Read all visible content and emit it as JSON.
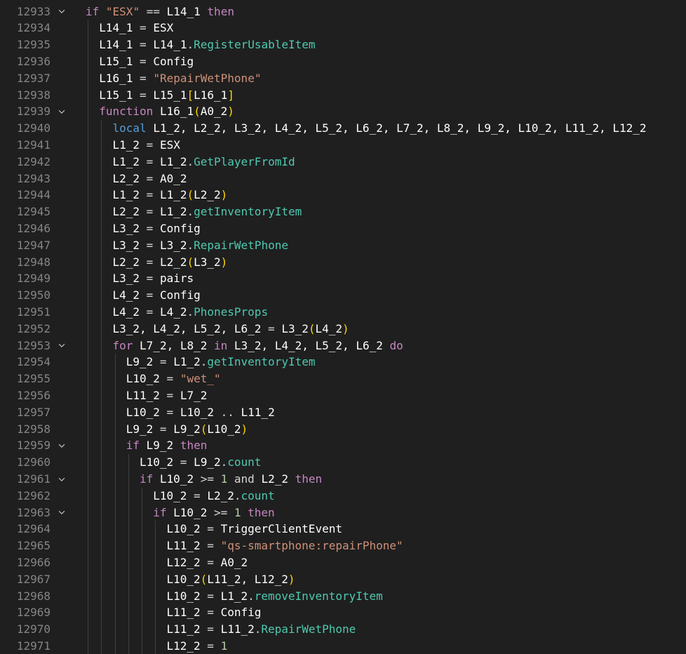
{
  "editor": {
    "first_line": 12933,
    "fold_icon": "chevron-down-icon",
    "colors": {
      "background": "#1f1f1f",
      "line_number": "#858585",
      "keyword": "#c586c0",
      "local_keyword": "#569cd6",
      "string": "#ce9178",
      "property": "#4ec9b0",
      "number": "#b5cea8",
      "bracket": "#ffd700",
      "identifier": "#ffffff"
    },
    "lines": [
      {
        "n": "12933",
        "fold": true,
        "indent": 0,
        "tokens": [
          [
            "kw",
            "if"
          ],
          [
            "op",
            " "
          ],
          [
            "str",
            "\"ESX\""
          ],
          [
            "op",
            " == "
          ],
          [
            "var",
            "L14_1"
          ],
          [
            "op",
            " "
          ],
          [
            "kw",
            "then"
          ]
        ]
      },
      {
        "n": "12934",
        "fold": false,
        "indent": 1,
        "tokens": [
          [
            "var",
            "L14_1"
          ],
          [
            "op",
            " = "
          ],
          [
            "var",
            "ESX"
          ]
        ]
      },
      {
        "n": "12935",
        "fold": false,
        "indent": 1,
        "tokens": [
          [
            "var",
            "L14_1"
          ],
          [
            "op",
            " = "
          ],
          [
            "var",
            "L14_1"
          ],
          [
            "op",
            "."
          ],
          [
            "fn",
            "RegisterUsableItem"
          ]
        ]
      },
      {
        "n": "12936",
        "fold": false,
        "indent": 1,
        "tokens": [
          [
            "var",
            "L15_1"
          ],
          [
            "op",
            " = "
          ],
          [
            "var",
            "Config"
          ]
        ]
      },
      {
        "n": "12937",
        "fold": false,
        "indent": 1,
        "tokens": [
          [
            "var",
            "L16_1"
          ],
          [
            "op",
            " = "
          ],
          [
            "str",
            "\"RepairWetPhone\""
          ]
        ]
      },
      {
        "n": "12938",
        "fold": false,
        "indent": 1,
        "tokens": [
          [
            "var",
            "L15_1"
          ],
          [
            "op",
            " = "
          ],
          [
            "var",
            "L15_1"
          ],
          [
            "br",
            "["
          ],
          [
            "var",
            "L16_1"
          ],
          [
            "br",
            "]"
          ]
        ]
      },
      {
        "n": "12939",
        "fold": true,
        "indent": 1,
        "tokens": [
          [
            "kw",
            "function"
          ],
          [
            "op",
            " "
          ],
          [
            "var",
            "L16_1"
          ],
          [
            "br",
            "("
          ],
          [
            "var",
            "A0_2"
          ],
          [
            "br",
            ")"
          ]
        ]
      },
      {
        "n": "12940",
        "fold": false,
        "indent": 2,
        "tokens": [
          [
            "kwb",
            "local"
          ],
          [
            "op",
            " "
          ],
          [
            "var",
            "L1_2, L2_2, L3_2, L4_2, L5_2, L6_2, L7_2, L8_2, L9_2, L10_2, L11_2, L12_2"
          ]
        ]
      },
      {
        "n": "12941",
        "fold": false,
        "indent": 2,
        "tokens": [
          [
            "var",
            "L1_2"
          ],
          [
            "op",
            " = "
          ],
          [
            "var",
            "ESX"
          ]
        ]
      },
      {
        "n": "12942",
        "fold": false,
        "indent": 2,
        "tokens": [
          [
            "var",
            "L1_2"
          ],
          [
            "op",
            " = "
          ],
          [
            "var",
            "L1_2"
          ],
          [
            "op",
            "."
          ],
          [
            "fn",
            "GetPlayerFromId"
          ]
        ]
      },
      {
        "n": "12943",
        "fold": false,
        "indent": 2,
        "tokens": [
          [
            "var",
            "L2_2"
          ],
          [
            "op",
            " = "
          ],
          [
            "var",
            "A0_2"
          ]
        ]
      },
      {
        "n": "12944",
        "fold": false,
        "indent": 2,
        "tokens": [
          [
            "var",
            "L1_2"
          ],
          [
            "op",
            " = "
          ],
          [
            "var",
            "L1_2"
          ],
          [
            "br",
            "("
          ],
          [
            "var",
            "L2_2"
          ],
          [
            "br",
            ")"
          ]
        ]
      },
      {
        "n": "12945",
        "fold": false,
        "indent": 2,
        "tokens": [
          [
            "var",
            "L2_2"
          ],
          [
            "op",
            " = "
          ],
          [
            "var",
            "L1_2"
          ],
          [
            "op",
            "."
          ],
          [
            "fn",
            "getInventoryItem"
          ]
        ]
      },
      {
        "n": "12946",
        "fold": false,
        "indent": 2,
        "tokens": [
          [
            "var",
            "L3_2"
          ],
          [
            "op",
            " = "
          ],
          [
            "var",
            "Config"
          ]
        ]
      },
      {
        "n": "12947",
        "fold": false,
        "indent": 2,
        "tokens": [
          [
            "var",
            "L3_2"
          ],
          [
            "op",
            " = "
          ],
          [
            "var",
            "L3_2"
          ],
          [
            "op",
            "."
          ],
          [
            "fn",
            "RepairWetPhone"
          ]
        ]
      },
      {
        "n": "12948",
        "fold": false,
        "indent": 2,
        "tokens": [
          [
            "var",
            "L2_2"
          ],
          [
            "op",
            " = "
          ],
          [
            "var",
            "L2_2"
          ],
          [
            "br",
            "("
          ],
          [
            "var",
            "L3_2"
          ],
          [
            "br",
            ")"
          ]
        ]
      },
      {
        "n": "12949",
        "fold": false,
        "indent": 2,
        "tokens": [
          [
            "var",
            "L3_2"
          ],
          [
            "op",
            " = "
          ],
          [
            "var",
            "pairs"
          ]
        ]
      },
      {
        "n": "12950",
        "fold": false,
        "indent": 2,
        "tokens": [
          [
            "var",
            "L4_2"
          ],
          [
            "op",
            " = "
          ],
          [
            "var",
            "Config"
          ]
        ]
      },
      {
        "n": "12951",
        "fold": false,
        "indent": 2,
        "tokens": [
          [
            "var",
            "L4_2"
          ],
          [
            "op",
            " = "
          ],
          [
            "var",
            "L4_2"
          ],
          [
            "op",
            "."
          ],
          [
            "fn",
            "PhonesProps"
          ]
        ]
      },
      {
        "n": "12952",
        "fold": false,
        "indent": 2,
        "tokens": [
          [
            "var",
            "L3_2, L4_2, L5_2, L6_2"
          ],
          [
            "op",
            " = "
          ],
          [
            "var",
            "L3_2"
          ],
          [
            "br",
            "("
          ],
          [
            "var",
            "L4_2"
          ],
          [
            "br",
            ")"
          ]
        ]
      },
      {
        "n": "12953",
        "fold": true,
        "indent": 2,
        "tokens": [
          [
            "kw",
            "for"
          ],
          [
            "op",
            " "
          ],
          [
            "var",
            "L7_2, L8_2"
          ],
          [
            "op",
            " "
          ],
          [
            "kw",
            "in"
          ],
          [
            "op",
            " "
          ],
          [
            "var",
            "L3_2, L4_2, L5_2, L6_2"
          ],
          [
            "op",
            " "
          ],
          [
            "kw",
            "do"
          ]
        ]
      },
      {
        "n": "12954",
        "fold": false,
        "indent": 3,
        "tokens": [
          [
            "var",
            "L9_2"
          ],
          [
            "op",
            " = "
          ],
          [
            "var",
            "L1_2"
          ],
          [
            "op",
            "."
          ],
          [
            "fn",
            "getInventoryItem"
          ]
        ]
      },
      {
        "n": "12955",
        "fold": false,
        "indent": 3,
        "tokens": [
          [
            "var",
            "L10_2"
          ],
          [
            "op",
            " = "
          ],
          [
            "str",
            "\"wet_\""
          ]
        ]
      },
      {
        "n": "12956",
        "fold": false,
        "indent": 3,
        "tokens": [
          [
            "var",
            "L11_2"
          ],
          [
            "op",
            " = "
          ],
          [
            "var",
            "L7_2"
          ]
        ]
      },
      {
        "n": "12957",
        "fold": false,
        "indent": 3,
        "tokens": [
          [
            "var",
            "L10_2"
          ],
          [
            "op",
            " = "
          ],
          [
            "var",
            "L10_2"
          ],
          [
            "op",
            " .. "
          ],
          [
            "var",
            "L11_2"
          ]
        ]
      },
      {
        "n": "12958",
        "fold": false,
        "indent": 3,
        "tokens": [
          [
            "var",
            "L9_2"
          ],
          [
            "op",
            " = "
          ],
          [
            "var",
            "L9_2"
          ],
          [
            "br",
            "("
          ],
          [
            "var",
            "L10_2"
          ],
          [
            "br",
            ")"
          ]
        ]
      },
      {
        "n": "12959",
        "fold": true,
        "indent": 3,
        "tokens": [
          [
            "kw",
            "if"
          ],
          [
            "op",
            " "
          ],
          [
            "var",
            "L9_2"
          ],
          [
            "op",
            " "
          ],
          [
            "kw",
            "then"
          ]
        ]
      },
      {
        "n": "12960",
        "fold": false,
        "indent": 4,
        "tokens": [
          [
            "var",
            "L10_2"
          ],
          [
            "op",
            " = "
          ],
          [
            "var",
            "L9_2"
          ],
          [
            "op",
            "."
          ],
          [
            "fn",
            "count"
          ]
        ]
      },
      {
        "n": "12961",
        "fold": true,
        "indent": 4,
        "tokens": [
          [
            "kw",
            "if"
          ],
          [
            "op",
            " "
          ],
          [
            "var",
            "L10_2"
          ],
          [
            "op",
            " >= "
          ],
          [
            "num",
            "1"
          ],
          [
            "op",
            " "
          ],
          [
            "plain",
            "and"
          ],
          [
            "op",
            " "
          ],
          [
            "var",
            "L2_2"
          ],
          [
            "op",
            " "
          ],
          [
            "kw",
            "then"
          ]
        ]
      },
      {
        "n": "12962",
        "fold": false,
        "indent": 5,
        "tokens": [
          [
            "var",
            "L10_2"
          ],
          [
            "op",
            " = "
          ],
          [
            "var",
            "L2_2"
          ],
          [
            "op",
            "."
          ],
          [
            "fn",
            "count"
          ]
        ]
      },
      {
        "n": "12963",
        "fold": true,
        "indent": 5,
        "tokens": [
          [
            "kw",
            "if"
          ],
          [
            "op",
            " "
          ],
          [
            "var",
            "L10_2"
          ],
          [
            "op",
            " >= "
          ],
          [
            "num",
            "1"
          ],
          [
            "op",
            " "
          ],
          [
            "kw",
            "then"
          ]
        ]
      },
      {
        "n": "12964",
        "fold": false,
        "indent": 6,
        "tokens": [
          [
            "var",
            "L10_2"
          ],
          [
            "op",
            " = "
          ],
          [
            "var",
            "TriggerClientEvent"
          ]
        ]
      },
      {
        "n": "12965",
        "fold": false,
        "indent": 6,
        "tokens": [
          [
            "var",
            "L11_2"
          ],
          [
            "op",
            " = "
          ],
          [
            "str",
            "\"qs-smartphone:repairPhone\""
          ]
        ]
      },
      {
        "n": "12966",
        "fold": false,
        "indent": 6,
        "tokens": [
          [
            "var",
            "L12_2"
          ],
          [
            "op",
            " = "
          ],
          [
            "var",
            "A0_2"
          ]
        ]
      },
      {
        "n": "12967",
        "fold": false,
        "indent": 6,
        "tokens": [
          [
            "var",
            "L10_2"
          ],
          [
            "br",
            "("
          ],
          [
            "var",
            "L11_2, L12_2"
          ],
          [
            "br",
            ")"
          ]
        ]
      },
      {
        "n": "12968",
        "fold": false,
        "indent": 6,
        "tokens": [
          [
            "var",
            "L10_2"
          ],
          [
            "op",
            " = "
          ],
          [
            "var",
            "L1_2"
          ],
          [
            "op",
            "."
          ],
          [
            "fn",
            "removeInventoryItem"
          ]
        ]
      },
      {
        "n": "12969",
        "fold": false,
        "indent": 6,
        "tokens": [
          [
            "var",
            "L11_2"
          ],
          [
            "op",
            " = "
          ],
          [
            "var",
            "Config"
          ]
        ]
      },
      {
        "n": "12970",
        "fold": false,
        "indent": 6,
        "tokens": [
          [
            "var",
            "L11_2"
          ],
          [
            "op",
            " = "
          ],
          [
            "var",
            "L11_2"
          ],
          [
            "op",
            "."
          ],
          [
            "fn",
            "RepairWetPhone"
          ]
        ]
      },
      {
        "n": "12971",
        "fold": false,
        "indent": 6,
        "tokens": [
          [
            "var",
            "L12_2"
          ],
          [
            "op",
            " = "
          ],
          [
            "num",
            "1"
          ]
        ]
      }
    ]
  }
}
